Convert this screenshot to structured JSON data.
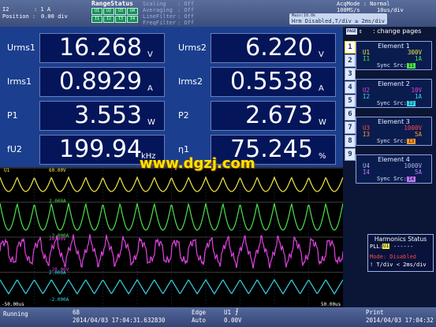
{
  "topbar": {
    "range_label": "I2",
    "range_value": ": 1 A",
    "position_label": "Position :",
    "position_value": "0.00 div",
    "range_status_title": "RangeStatus",
    "range_boxes": [
      "U1",
      "U2",
      "U3",
      "U4",
      "I1",
      "I2",
      "I3",
      "I4"
    ],
    "settings": [
      {
        "label": "Scaling",
        "value": ": Off"
      },
      {
        "label": "Averaging",
        "value": ": Off"
      },
      {
        "label": "LineFilter",
        "value": ": Off"
      },
      {
        "label": "FreqFilter",
        "value": ": Off"
      }
    ],
    "acq_mode": "AcqMode : Normal",
    "sample_rate": "100MS/s",
    "time_div": "10us/div",
    "main": "Main:10.0k",
    "hrm_message": "Hrm Disabled,T/div ≥ 2ms/div"
  },
  "measurements": [
    {
      "label": "Urms1",
      "value": "16.268",
      "unit": "V"
    },
    {
      "label": "Urms2",
      "value": "6.220",
      "unit": "V"
    },
    {
      "label": "Irms1",
      "value": "0.8929",
      "unit": "A"
    },
    {
      "label": "Irms2",
      "value": "0.5538",
      "unit": "A"
    },
    {
      "label": "P1",
      "value": "3.553",
      "unit": "W"
    },
    {
      "label": "P2",
      "value": "2.673",
      "unit": "W"
    },
    {
      "label": "fU2",
      "value": "199.94",
      "unit": "kHz"
    },
    {
      "label": "η1",
      "value": "75.245",
      "unit": "%"
    }
  ],
  "page": {
    "page_label": "PAGE",
    "change_pages": ": change pages",
    "tabs": [
      "1",
      "2",
      "3",
      "4",
      "5",
      "6",
      "7",
      "8",
      "9"
    ]
  },
  "elements": [
    {
      "title": "Element 1",
      "u_label": "U1",
      "u_value": "300V",
      "i_label": "I1",
      "i_value": "1A",
      "sync": "Sync Src:",
      "sync_badge": "I1",
      "u_color": "#f2e94a",
      "i_color": "#4be34b"
    },
    {
      "title": "Element 2",
      "u_label": "U2",
      "u_value": "10V",
      "i_label": "I2",
      "i_value": "1A",
      "sync": "Sync Src:",
      "sync_badge": "I2",
      "u_color": "#e043e0",
      "i_color": "#37d5e6"
    },
    {
      "title": "Element 3",
      "u_label": "U3",
      "u_value": "1000V",
      "i_label": "I3",
      "i_value": "5A",
      "sync": "Sync Src:",
      "sync_badge": "I3",
      "u_color": "#ff4a4a",
      "i_color": "#ff9a2e"
    },
    {
      "title": "Element 4",
      "u_label": "U4",
      "u_value": "1000V",
      "i_label": "I4",
      "i_value": "5A",
      "sync": "Sync Src:",
      "sync_badge": "I4",
      "u_color": "#a9b8e6",
      "i_color": "#c277ff"
    }
  ],
  "harmonics": {
    "title": "Harmonics Status",
    "pll": "PLL:",
    "pll_badge": "U1",
    "pll_value": "------",
    "mode": "Mode: Disabled",
    "note": "! T/div < 2ms/div"
  },
  "waveform": {
    "ch1_label": "U1",
    "ch1_top": "60.00V",
    "ch2_top": "2.000A",
    "ch2_bottom": "-2.000A",
    "ch3_top": "20.00V",
    "ch3_bottom": "-20.00V",
    "ch4_top": "2.000A",
    "ch4_bottom": "-2.000A",
    "time_left": "-50.00us",
    "time_right": "50.00us"
  },
  "bottombar": {
    "status": "Running",
    "count": "68",
    "timestamp1": "2014/04/03 17:04:31.632830",
    "trigger_slope": "Edge",
    "trigger_mode": "Auto",
    "trigger_source": "U1",
    "trigger_level": "0.00V",
    "print_label": "Print",
    "timestamp2": "2014/04/03 17:04:32"
  },
  "watermark": "www.dgzj.com",
  "colors": {
    "u1": "#f2e94a",
    "i1": "#4be34b",
    "u2": "#e043e0",
    "i2": "#37d5e6"
  }
}
